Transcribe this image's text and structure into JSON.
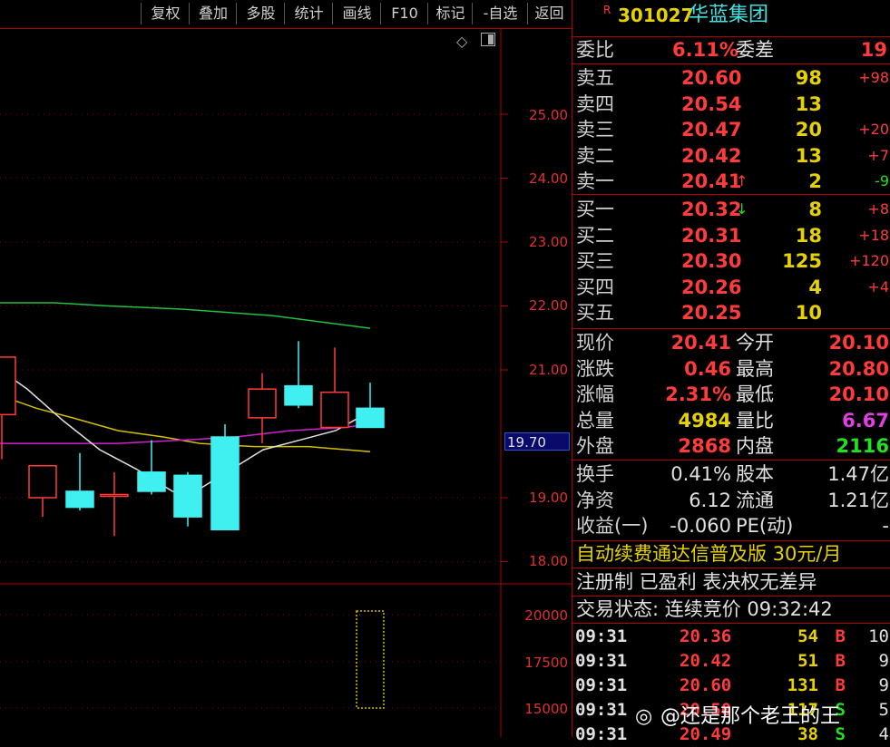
{
  "toolbar": {
    "items": [
      "复权",
      "叠加",
      "多股",
      "统计",
      "画线",
      "F10",
      "标记",
      "-自选",
      "返回"
    ]
  },
  "chart": {
    "price_ticks": [
      "25.00",
      "24.00",
      "23.00",
      "22.00",
      "21.00",
      "19.00",
      "18.00"
    ],
    "current_price_marker": "19.70",
    "volume_ticks": [
      "20000",
      "17500",
      "15000"
    ]
  },
  "chart_data": {
    "type": "candlestick",
    "ylim": [
      18.0,
      25.0
    ],
    "candles": [
      {
        "open": 20.3,
        "high": 20.9,
        "low": 19.6,
        "close": 21.2
      },
      {
        "open": 19.0,
        "high": 19.5,
        "low": 18.7,
        "close": 19.5
      },
      {
        "open": 19.1,
        "high": 19.7,
        "low": 18.8,
        "close": 18.85
      },
      {
        "open": 19.05,
        "high": 19.4,
        "low": 18.4,
        "close": 19.05
      },
      {
        "open": 19.4,
        "high": 19.9,
        "low": 19.05,
        "close": 19.1
      },
      {
        "open": 19.35,
        "high": 19.4,
        "low": 18.55,
        "close": 18.7
      },
      {
        "open": 19.95,
        "high": 20.15,
        "low": 18.5,
        "close": 18.5
      },
      {
        "open": 20.25,
        "high": 20.95,
        "low": 19.85,
        "close": 20.7
      },
      {
        "open": 20.75,
        "high": 21.45,
        "low": 20.4,
        "close": 20.45
      },
      {
        "open": 20.1,
        "high": 21.35,
        "low": 20.1,
        "close": 20.65
      },
      {
        "open": 20.4,
        "high": 20.8,
        "low": 20.1,
        "close": 20.1
      }
    ],
    "volume_bar_last": 20000
  },
  "panel": {
    "title_badge": "R",
    "code": "301027",
    "name": "华蓝集团",
    "weibi_label": "委比",
    "weibi_value": "6.11%",
    "weicha_label": "委差",
    "weicha_value": "19",
    "asks": [
      {
        "label": "卖五",
        "price": "20.60",
        "vol": "98",
        "chg": "+98"
      },
      {
        "label": "卖四",
        "price": "20.54",
        "vol": "13",
        "chg": ""
      },
      {
        "label": "卖三",
        "price": "20.47",
        "vol": "20",
        "chg": "+20"
      },
      {
        "label": "卖二",
        "price": "20.42",
        "vol": "13",
        "chg": "+7"
      },
      {
        "label": "卖一",
        "price": "20.41",
        "vol": "2",
        "chg": "-9"
      }
    ],
    "bids": [
      {
        "label": "买一",
        "price": "20.32",
        "vol": "8",
        "chg": "+8"
      },
      {
        "label": "买二",
        "price": "20.31",
        "vol": "18",
        "chg": "+18"
      },
      {
        "label": "买三",
        "price": "20.30",
        "vol": "125",
        "chg": "+120"
      },
      {
        "label": "买四",
        "price": "20.26",
        "vol": "4",
        "chg": "+4"
      },
      {
        "label": "买五",
        "price": "20.25",
        "vol": "10",
        "chg": ""
      }
    ],
    "stats": [
      {
        "l1": "现价",
        "v1": "20.41",
        "l2": "今开",
        "v2": "20.10"
      },
      {
        "l1": "涨跌",
        "v1": "0.46",
        "l2": "最高",
        "v2": "20.80"
      },
      {
        "l1": "涨幅",
        "v1": "2.31%",
        "l2": "最低",
        "v2": "20.10"
      },
      {
        "l1": "总量",
        "v1": "4984",
        "l2": "量比",
        "v2": "6.67"
      },
      {
        "l1": "外盘",
        "v1": "2868",
        "l2": "内盘",
        "v2": "2116"
      }
    ],
    "fund": [
      {
        "l1": "换手",
        "v1": "0.41%",
        "l2": "股本",
        "v2": "1.47亿"
      },
      {
        "l1": "净资",
        "v1": "6.12",
        "l2": "流通",
        "v2": "1.21亿"
      },
      {
        "l1": "收益(一)",
        "v1": "-0.060",
        "l2": "PE(动)",
        "v2": "-"
      }
    ],
    "promo": "自动续费通达信普及版  30元/月",
    "tags": "注册制 已盈利 表决权无差异",
    "trade_status": "交易状态: 连续竞价 09:32:42",
    "ticks": [
      {
        "time": "09:31",
        "price": "20.36",
        "vol": "54",
        "side": "B",
        "n": "10"
      },
      {
        "time": "09:31",
        "price": "20.42",
        "vol": "51",
        "side": "B",
        "n": "9"
      },
      {
        "time": "09:31",
        "price": "20.60",
        "vol": "131",
        "side": "B",
        "n": "9"
      },
      {
        "time": "09:31",
        "price": "20.50",
        "vol": "117",
        "side": "S",
        "n": "5"
      },
      {
        "time": "09:31",
        "price": "20.49",
        "vol": "38",
        "side": "S",
        "n": "4"
      }
    ]
  },
  "watermark": "@还是那个老王的王"
}
